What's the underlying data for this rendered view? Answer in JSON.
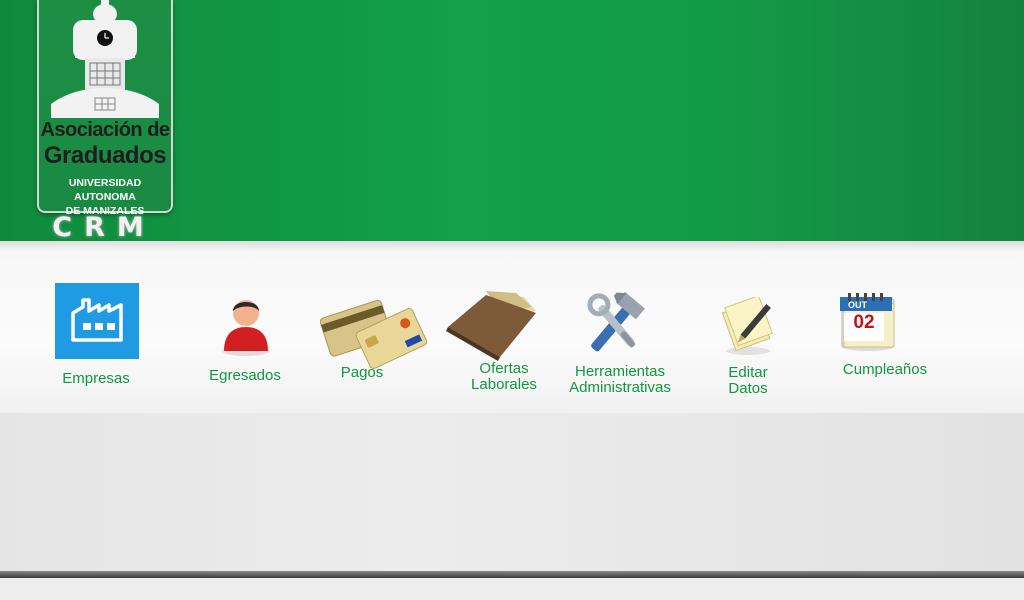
{
  "logo": {
    "line1": "Asociación de",
    "line2": "Graduados",
    "line3a": "UNIVERSIDAD AUTONOMA",
    "line3b": "DE MANIZALES",
    "crm": "CRM"
  },
  "menu": {
    "items": [
      {
        "label": "Empresas",
        "icon": "factory-icon"
      },
      {
        "label": "Egresados",
        "icon": "user-icon"
      },
      {
        "label": "Pagos",
        "icon": "credit-cards-icon"
      },
      {
        "label1": "Ofertas",
        "label2": "Laborales",
        "icon": "folder-icon"
      },
      {
        "label1": "Herramientas",
        "label2": "Administrativas",
        "icon": "tools-icon"
      },
      {
        "label1": "Editar",
        "label2": "Datos",
        "icon": "edit-notes-icon"
      },
      {
        "label": "Cumpleaños",
        "icon": "calendar-icon",
        "calendar_month": "OUT",
        "calendar_day": "02"
      }
    ]
  },
  "colors": {
    "header_green": "#12a04a",
    "label_green": "#11973f",
    "tile_blue": "#1e9be3"
  }
}
